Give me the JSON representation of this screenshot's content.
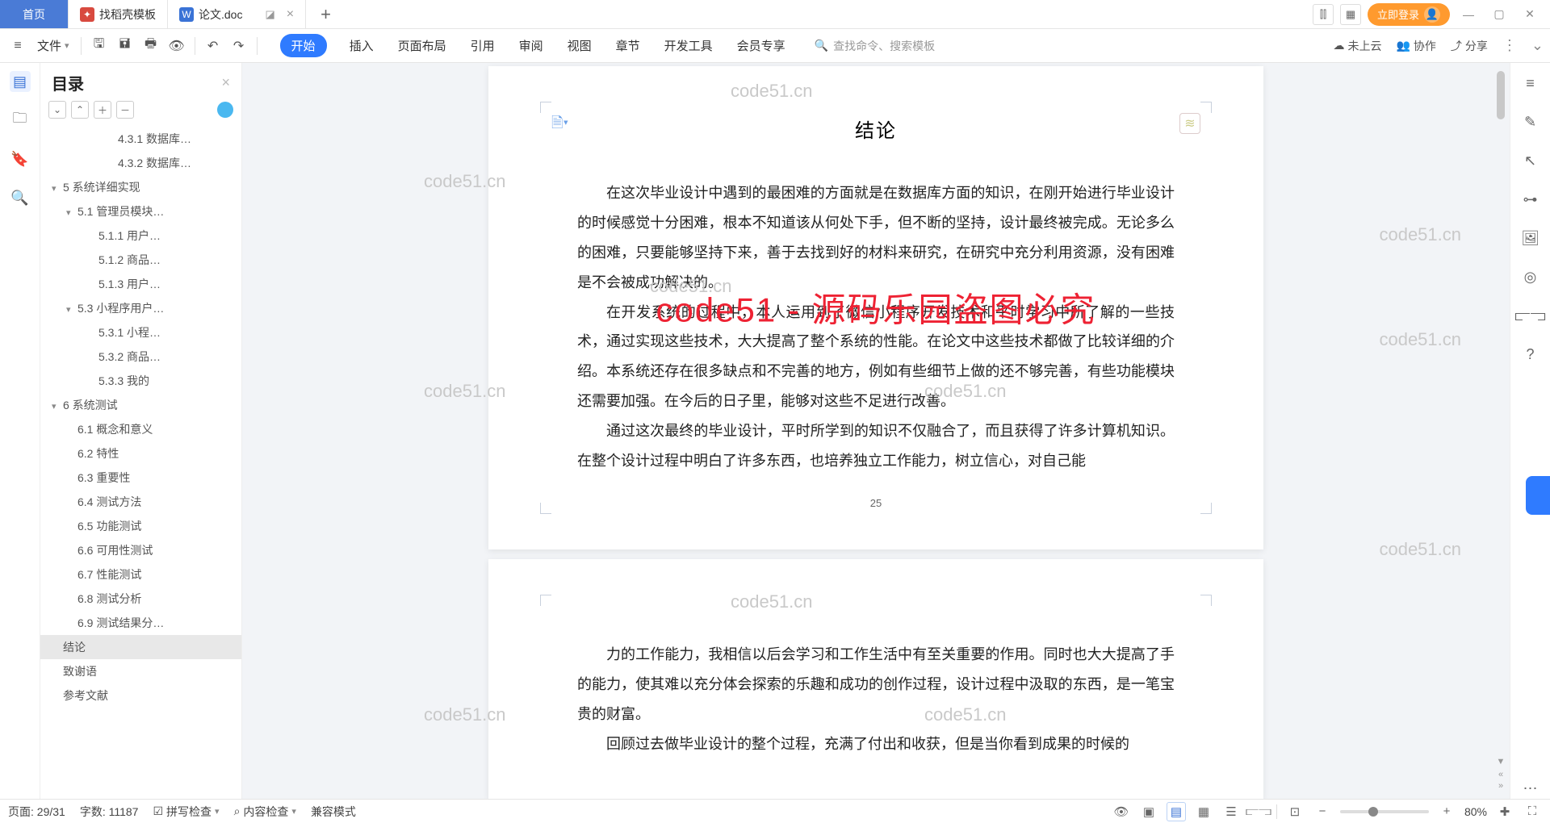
{
  "tabs": {
    "home": "首页",
    "t1": "找稻壳模板",
    "t2": "论文.doc"
  },
  "login": "立即登录",
  "file_menu": "文件",
  "ribbon": [
    "开始",
    "插入",
    "页面布局",
    "引用",
    "审阅",
    "视图",
    "章节",
    "开发工具",
    "会员专享"
  ],
  "search_placeholder": "查找命令、搜索模板",
  "cloud": "未上云",
  "collab": "协作",
  "share": "分享",
  "outline_title": "目录",
  "outline": [
    {
      "d": 4,
      "t": "4.3.1 数据库…"
    },
    {
      "d": 4,
      "t": "4.3.2 数据库…"
    },
    {
      "d": 1,
      "t": "5 系统详细实现",
      "c": "▾"
    },
    {
      "d": 2,
      "t": "5.1 管理员模块…",
      "c": "▾"
    },
    {
      "d": 3,
      "t": "5.1.1 用户…"
    },
    {
      "d": 3,
      "t": "5.1.2 商品…"
    },
    {
      "d": 3,
      "t": "5.1.3 用户…"
    },
    {
      "d": 2,
      "t": "5.3 小程序用户…",
      "c": "▾"
    },
    {
      "d": 3,
      "t": "5.3.1 小程…"
    },
    {
      "d": 3,
      "t": "5.3.2 商品…"
    },
    {
      "d": 3,
      "t": "5.3.3 我的"
    },
    {
      "d": 1,
      "t": "6 系统测试",
      "c": "▾"
    },
    {
      "d": 2,
      "t": "6.1 概念和意义"
    },
    {
      "d": 2,
      "t": "6.2 特性"
    },
    {
      "d": 2,
      "t": "6.3 重要性"
    },
    {
      "d": 2,
      "t": "6.4 测试方法"
    },
    {
      "d": 2,
      "t": "6.5 功能测试"
    },
    {
      "d": 2,
      "t": "6.6 可用性测试"
    },
    {
      "d": 2,
      "t": "6.7 性能测试"
    },
    {
      "d": 2,
      "t": "6.8 测试分析"
    },
    {
      "d": 2,
      "t": "6.9 测试结果分…"
    },
    {
      "d": 1,
      "t": "结论",
      "sel": true
    },
    {
      "d": 1,
      "t": "致谢语"
    },
    {
      "d": 1,
      "t": "参考文献"
    }
  ],
  "doc": {
    "heading": "结论",
    "p1": "在这次毕业设计中遇到的最困难的方面就是在数据库方面的知识，在刚开始进行毕业设计的时候感觉十分困难，根本不知道该从何处下手，但不断的坚持，设计最终被完成。无论多么的困难，只要能够坚持下来，善于去找到好的材料来研究，在研究中充分利用资源，没有困难是不会被成功解决的。",
    "p2": "在开发系统的过程中，本人运用到了微信小程序开发技术和平时学习中所了解的一些技术，通过实现这些技术，大大提高了整个系统的性能。在论文中这些技术都做了比较详细的介绍。本系统还存在很多缺点和不完善的地方，例如有些细节上做的还不够完善，有些功能模块还需要加强。在今后的日子里，能够对这些不足进行改善。",
    "p3": "通过这次最终的毕业设计，平时所学到的知识不仅融合了，而且获得了许多计算机知识。在整个设计过程中明白了许多东西，也培养独立工作能力，树立信心，对自己能",
    "pagenum": "25",
    "p4": "力的工作能力，我相信以后会学习和工作生活中有至关重要的作用。同时也大大提高了手的能力，使其难以充分体会探索的乐趣和成功的创作过程，设计过程中汲取的东西，是一笔宝贵的财富。",
    "p5": "回顾过去做毕业设计的整个过程，充满了付出和收获，但是当你看到成果的时候的"
  },
  "wm": "code51.cn",
  "wm_red": "code51 - 源码乐园盗图必究",
  "status": {
    "page": "页面: 29/31",
    "words": "字数: 11187",
    "spell": "拼写检查",
    "content": "内容检查",
    "compat": "兼容模式",
    "zoom": "80%"
  }
}
